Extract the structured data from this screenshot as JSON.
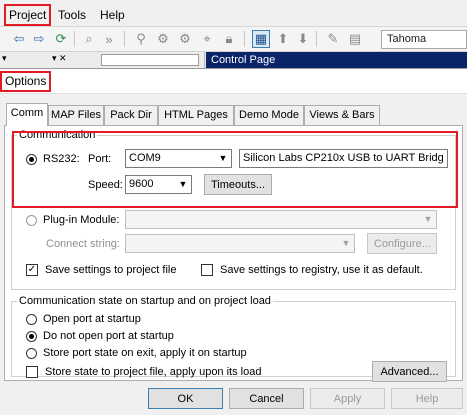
{
  "menu": {
    "items": [
      "Project",
      "Tools",
      "Help"
    ]
  },
  "toolbar": {
    "font_name": "Tahoma",
    "icons": [
      "back-arrow-icon",
      "forward-arrow-icon",
      "refresh-icon",
      "find-icon",
      "more-icon",
      "binoculars-icon",
      "replace-icon",
      "zoom-icon",
      "lock-icon",
      "grid-icon",
      "up-arrow-icon",
      "down-arrow-icon",
      "edit-icon",
      "properties-icon"
    ]
  },
  "background_window": {
    "title": "Control Page"
  },
  "dialog": {
    "title": "Options",
    "tabs": [
      "Comm",
      "MAP Files",
      "Pack Dir",
      "HTML Pages",
      "Demo Mode",
      "Views & Bars"
    ],
    "active_tab": "Comm",
    "communication": {
      "label": "Communication",
      "rs232_label": "RS232:",
      "port_label": "Port:",
      "port_value": "COM9",
      "port_description": "Silicon Labs CP210x USB to UART Bridg",
      "speed_label": "Speed:",
      "speed_value": "9600",
      "timeouts_label": "Timeouts...",
      "plugin_label": "Plug-in Module:",
      "connect_string_label": "Connect string:",
      "configure_label": "Configure...",
      "save_project_label": "Save settings to project file",
      "save_registry_label": "Save settings to registry, use it as default."
    },
    "startup": {
      "label": "Communication state on startup and on project load",
      "options": [
        "Open port at startup",
        "Do not open port at startup",
        "Store port state on exit, apply it on startup"
      ],
      "selected": "Do not open port at startup",
      "store_state_label": "Store state to project file, apply upon its load",
      "advanced_label": "Advanced..."
    },
    "buttons": {
      "ok": "OK",
      "cancel": "Cancel",
      "apply": "Apply",
      "help": "Help"
    },
    "highlight_color": "#e01b24"
  }
}
